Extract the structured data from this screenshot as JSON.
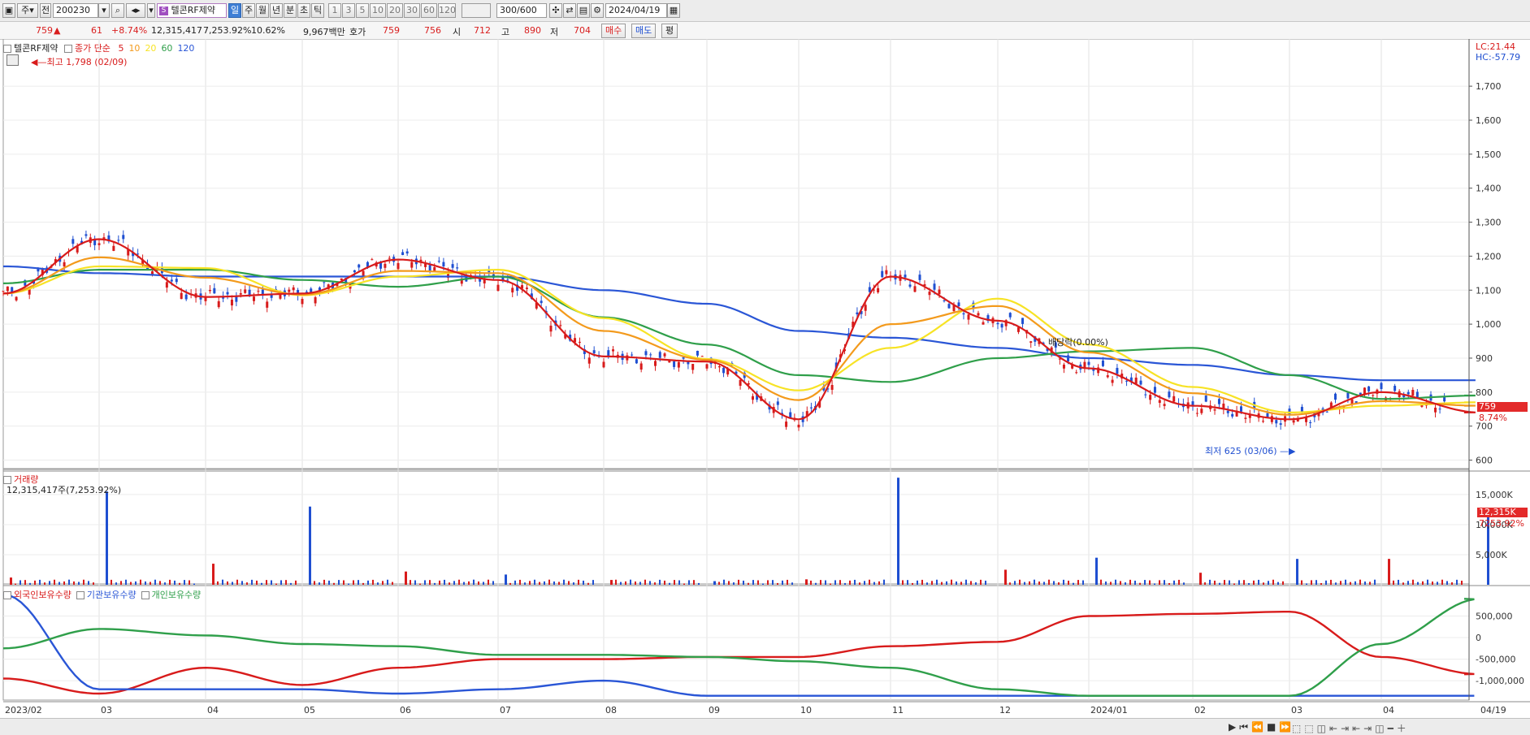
{
  "toolbar": {
    "market": "주",
    "type": "전",
    "code": "200230",
    "stock_name": "텔콘RF제약",
    "periods": [
      "일",
      "주",
      "월",
      "년",
      "분",
      "초",
      "틱"
    ],
    "active_period": "일",
    "intervals": [
      "1",
      "3",
      "5",
      "10",
      "20",
      "30",
      "60",
      "120"
    ],
    "count": "300",
    "count_total": "/600",
    "date": "2024/04/19"
  },
  "quote": {
    "price": "759",
    "arrow": "▲",
    "change": "61",
    "change_pct": "+8.74%",
    "volume": "12,315,417",
    "volume_pct": "7,253.92%",
    "turnover_pct": "10.62%",
    "amount": "9,967백만",
    "bid_label": "호가",
    "bid1": "759",
    "bid2": "756",
    "open_label": "시",
    "open": "712",
    "high_label": "고",
    "high": "890",
    "low_label": "저",
    "low": "704",
    "buy_label": "매수",
    "sell_label": "매도",
    "avg_label": "평"
  },
  "price_panel": {
    "title": "텔콘RF제약",
    "ma_label": "종가 단순",
    "ma_periods": [
      "5",
      "10",
      "20",
      "60",
      "120"
    ],
    "ma_colors": [
      "#d81b1b",
      "#f39a1c",
      "#f7e325",
      "#2f9f4a",
      "#2a56d6"
    ],
    "lc": "LC:21.44",
    "hc": "HC:-57.79",
    "high_marker": "최고 1,798 (02/09)",
    "low_marker": "최저 625 (03/06)",
    "event_label": "배당락(0.00%)",
    "price_tag": "759",
    "pct_tag": "8.74%",
    "y_ticks": [
      "1,700",
      "1,600",
      "1,500",
      "1,400",
      "1,300",
      "1,200",
      "1,100",
      "1,000",
      "900",
      "800",
      "700",
      "600"
    ]
  },
  "volume_panel": {
    "title": "거래량",
    "summary": "12,315,417주(7,253.92%)",
    "y_ticks": [
      "15,000K",
      "10,000K",
      "5,000K"
    ],
    "tag": "12,315K",
    "tag2": "7253.92%"
  },
  "holders_panel": {
    "series": [
      "외국인보유수량",
      "기관보유수량",
      "개인보유수량"
    ],
    "colors": [
      "#d81b1b",
      "#2a56d6",
      "#2f9f4a"
    ],
    "y_ticks": [
      "500,000",
      "0",
      "-500,000",
      "-1,000,000"
    ]
  },
  "x_axis": [
    "2023/02",
    "03",
    "04",
    "05",
    "06",
    "07",
    "08",
    "09",
    "10",
    "11",
    "12",
    "2024/01",
    "02",
    "03",
    "04",
    "04/19"
  ],
  "chart_data": {
    "type": "line",
    "title": "텔콘RF제약",
    "x": [
      "2023/02",
      "03",
      "04",
      "05",
      "06",
      "07",
      "08",
      "09",
      "10",
      "11",
      "12",
      "2024/01",
      "02",
      "03",
      "04",
      "04/19"
    ],
    "ylim": [
      575,
      1815
    ],
    "series": [
      {
        "name": "종가 단순 5",
        "values": [
          1090,
          1250,
          1080,
          1090,
          1190,
          1130,
          905,
          890,
          720,
          1140,
          1010,
          870,
          760,
          720,
          800,
          740
        ]
      },
      {
        "name": "종가 단순 60",
        "values": [
          1120,
          1160,
          1160,
          1130,
          1110,
          1140,
          1020,
          940,
          850,
          830,
          900,
          920,
          930,
          850,
          780,
          790
        ]
      },
      {
        "name": "종가 단순 120",
        "values": [
          1170,
          1150,
          1140,
          1140,
          1140,
          1140,
          1100,
          1060,
          980,
          960,
          930,
          900,
          880,
          850,
          835,
          835
        ]
      }
    ],
    "volume_k": [
      1200,
      15500,
      3500,
      13000,
      2200,
      1700,
      800,
      600,
      900,
      17800,
      2500,
      4500,
      2000,
      4300,
      4300,
      12315
    ],
    "holdings": [
      {
        "name": "외국인보유수량",
        "values": [
          -950000,
          -1300000,
          -700000,
          -1100000,
          -700000,
          -500000,
          -500000,
          -450000,
          -450000,
          -200000,
          -100000,
          500000,
          550000,
          600000,
          -450000,
          -850000
        ]
      },
      {
        "name": "기관보유수량",
        "values": [
          1000000,
          -1200000,
          -1200000,
          -1200000,
          -1300000,
          -1200000,
          -1000000,
          -1350000,
          -1350000,
          -1350000,
          -1350000,
          -1350000,
          -1350000,
          -1350000,
          -1350000,
          -1350000
        ]
      },
      {
        "name": "개인보유수량",
        "values": [
          -250000,
          200000,
          50000,
          -150000,
          -200000,
          -400000,
          -400000,
          -450000,
          -550000,
          -700000,
          -1200000,
          -1350000,
          -1350000,
          -1350000,
          -150000,
          900000
        ]
      }
    ],
    "markers": {
      "high": "최고 1,798 (02/09)",
      "low": "최저 625 (03/06)",
      "event": "배당락(0.00%)"
    }
  }
}
